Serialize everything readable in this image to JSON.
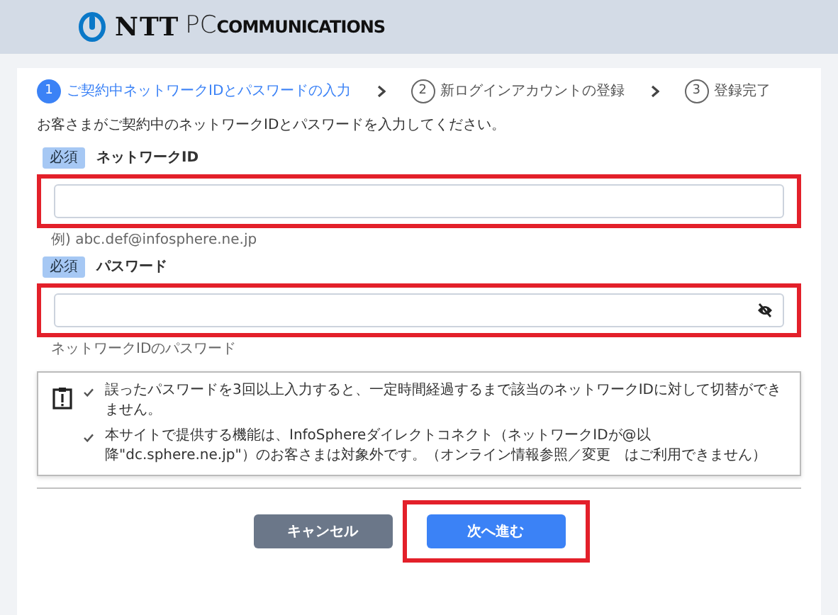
{
  "header": {
    "logo": [
      "NTT",
      "PC",
      "COMMUNICATIONS"
    ]
  },
  "steps": [
    {
      "number": "1",
      "label": "ご契約中ネットワークIDとパスワードの入力",
      "selected": true
    },
    {
      "number": "2",
      "label": "新ログインアカウントの登録",
      "selected": false
    },
    {
      "number": "3",
      "label": "登録完了",
      "selected": false
    }
  ],
  "instruction": "お客さまがご契約中のネットワークIDとパスワードを入力してください。",
  "fields": [
    {
      "kind": "text",
      "badge": "必須",
      "label": "ネットワークID",
      "hint": "例) abc.def@infosphere.ne.jp",
      "highlighted": true
    },
    {
      "kind": "password",
      "badge": "必須",
      "label": "パスワード",
      "hint": "ネットワークIDのパスワード",
      "highlighted": true
    }
  ],
  "notice": [
    "誤ったパスワードを3回以上入力すると、一定時間経過するまで該当のネットワークIDに対して切替ができません。",
    "本サイトで提供する機能は、InfoSphereダイレクトコネクト（ネットワークIDが@以降\"dc.sphere.ne.jp\"）のお客さまは対象外です。（オンライン情報参照／変更　はご利用できません）"
  ],
  "buttons": [
    {
      "kind": "secondary",
      "label": "キャンセル",
      "highlighted": false
    },
    {
      "kind": "primary",
      "label": "次へ進む",
      "highlighted": true
    }
  ]
}
